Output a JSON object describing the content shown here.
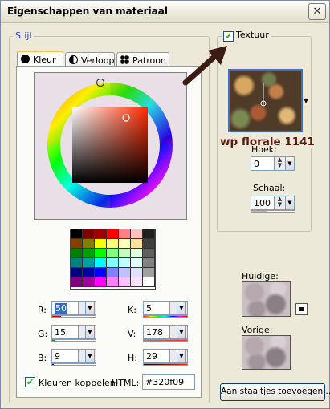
{
  "window": {
    "title": "Eigenschappen van materiaal",
    "close_glyph": "✕"
  },
  "stijl": {
    "legend": "Stijl",
    "tabs": [
      {
        "label": "Kleur",
        "icon": "solid-dot-icon"
      },
      {
        "label": "Verloop",
        "icon": "gradient-icon"
      },
      {
        "label": "Patroon",
        "icon": "pattern-icon"
      }
    ],
    "active_tab": "Kleur"
  },
  "color_values": {
    "r": {
      "label": "R:",
      "value": "50"
    },
    "g": {
      "label": "G:",
      "value": "15"
    },
    "b": {
      "label": "B:",
      "value": "9"
    },
    "k": {
      "label": "K:",
      "value": "5"
    },
    "v": {
      "label": "V:",
      "value": "178"
    },
    "h": {
      "label": "H:",
      "value": "29"
    }
  },
  "link_colors": {
    "label": "Kleuren koppelen",
    "checked": true
  },
  "html_field": {
    "label": "HTML:",
    "value": "#320f09"
  },
  "texture": {
    "legend": "Textuur",
    "checked": true,
    "name": "wp florale 1141",
    "angle_label": "Hoek:",
    "angle_value": "0",
    "scale_label": "Schaal:",
    "scale_value": "100"
  },
  "current_label": "Huidige:",
  "previous_label": "Vorige:",
  "add_swatch_button": "Aan staaltjes toevoegen...",
  "palette_colors": [
    "#000000",
    "#800000",
    "#a00000",
    "#ff0000",
    "#ff8080",
    "#ffc0c0",
    "#202020",
    "#804000",
    "#808000",
    "#ffff00",
    "#ffff80",
    "#ffffc0",
    "#ffe0a0",
    "#404040",
    "#008000",
    "#00a000",
    "#00ff00",
    "#80ff80",
    "#c0ffc0",
    "#e0ffe0",
    "#606060",
    "#008080",
    "#00a0a0",
    "#00ffff",
    "#80ffff",
    "#c0ffff",
    "#e0ffff",
    "#808080",
    "#000080",
    "#0000a0",
    "#0000ff",
    "#8080ff",
    "#c0c0ff",
    "#e0e0ff",
    "#a0a0a0",
    "#800080",
    "#a000a0",
    "#ff00ff",
    "#ff80ff",
    "#ffc0ff",
    "#ffe0ff",
    "#ffffff"
  ],
  "selected_color": "#320f09",
  "accent_color": "#3f6fc6"
}
